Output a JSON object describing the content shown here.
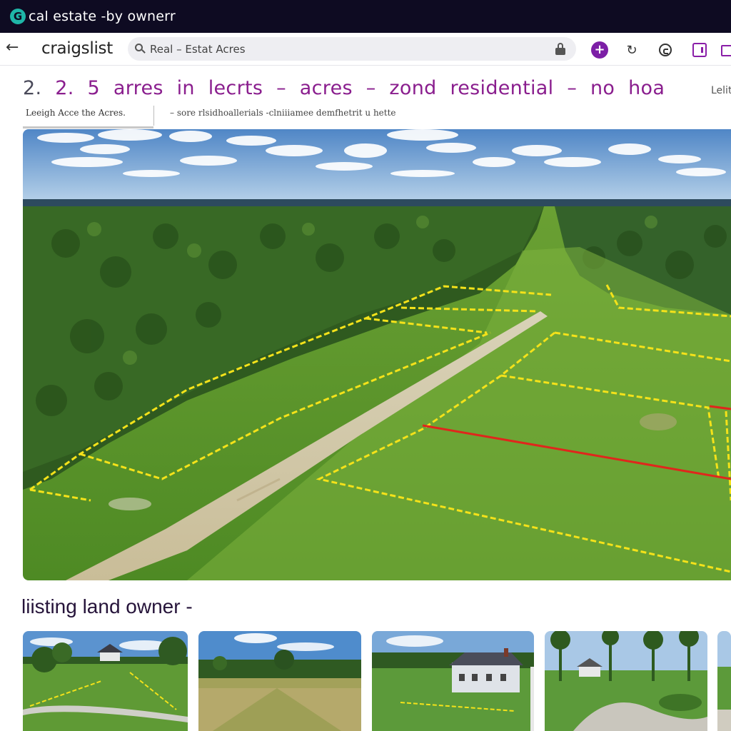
{
  "window": {
    "title": "cal estate -by ownerr",
    "app_icon_glyph": "G",
    "app_icon_color": "#1fb6a8"
  },
  "toolbar": {
    "back_icon": "arrow-left-icon",
    "brand": "craigslist",
    "search": {
      "value": "Real – Estat Acres",
      "placeholder": "Real – Estat Acres"
    },
    "accent_color": "#7c1fa6"
  },
  "listing": {
    "title_prefix": "2.",
    "title_main": "2. 5 arres in lecrts – acres – zond residential – no hoa",
    "side_label": "Lelit",
    "subtitle_left": "Leeigh Acce the Acres.",
    "subtitle_right": "– sore rlsidhoallerials -clniiiamee demfhetrit u hette"
  },
  "section": {
    "heading": "liisting land owner -"
  },
  "colors": {
    "titlebar": "#0e0b22",
    "title_text": "#8a1e8e",
    "boundary_yellow": "#f4e21a",
    "boundary_red": "#e0261c"
  }
}
